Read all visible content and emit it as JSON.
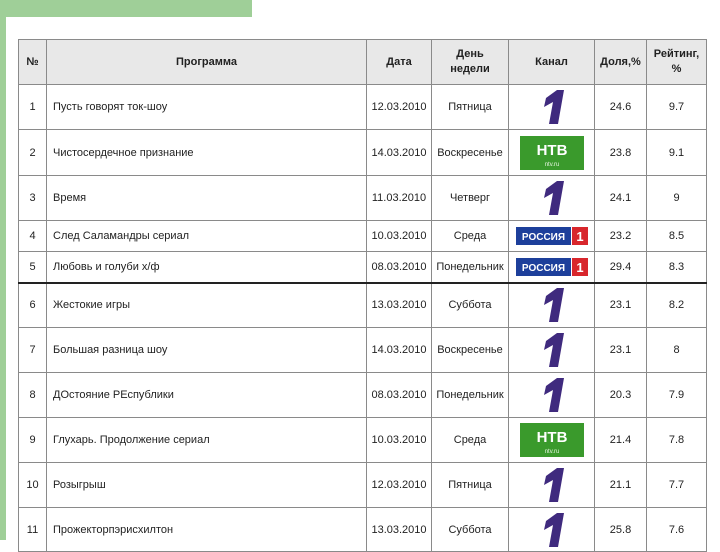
{
  "headers": {
    "num": "№",
    "program": "Программа",
    "date": "Дата",
    "day_line1": "День",
    "day_line2": "недели",
    "channel": "Канал",
    "share": "Доля,%",
    "rating_line1": "Рейтинг,",
    "rating_line2": "%"
  },
  "channel_logos": {
    "perviy": {
      "icon": "channel-one-logo",
      "color": "#3f2a7e"
    },
    "ntv": {
      "icon": "ntv-logo",
      "color": "#3a9a2c",
      "text": "НТВ",
      "subtext": "ntv.ru"
    },
    "rossiya": {
      "icon": "rossiya-1-logo",
      "color": "#1d3f9b",
      "accent": "#d8262c",
      "text": "РОССИЯ",
      "digit": "1"
    }
  },
  "rows": [
    {
      "num": "1",
      "program": "Пусть говорят ток-шоу",
      "date": "12.03.2010",
      "day": "Пятница",
      "channel": "perviy",
      "share": "24.6",
      "rating": "9.7"
    },
    {
      "num": "2",
      "program": "Чистосердечное признание",
      "date": "14.03.2010",
      "day": "Воскресенье",
      "channel": "ntv",
      "share": "23.8",
      "rating": "9.1"
    },
    {
      "num": "3",
      "program": "Время",
      "date": "11.03.2010",
      "day": "Четверг",
      "channel": "perviy",
      "share": "24.1",
      "rating": "9"
    },
    {
      "num": "4",
      "program": "След Саламандры сериал",
      "date": "10.03.2010",
      "day": "Среда",
      "channel": "rossiya",
      "share": "23.2",
      "rating": "8.5"
    },
    {
      "num": "5",
      "program": "Любовь и голуби х/ф",
      "date": "08.03.2010",
      "day": "Понедельник",
      "channel": "rossiya",
      "share": "29.4",
      "rating": "8.3"
    },
    {
      "num": "6",
      "program": "Жестокие игры",
      "date": "13.03.2010",
      "day": "Суббота",
      "channel": "perviy",
      "share": "23.1",
      "rating": "8.2"
    },
    {
      "num": "7",
      "program": "Большая разница шоу",
      "date": "14.03.2010",
      "day": "Воскресенье",
      "channel": "perviy",
      "share": "23.1",
      "rating": "8"
    },
    {
      "num": "8",
      "program": "ДОстояние РЕспублики",
      "date": "08.03.2010",
      "day": "Понедельник",
      "channel": "perviy",
      "share": "20.3",
      "rating": "7.9"
    },
    {
      "num": "9",
      "program": "Глухарь. Продолжение сериал",
      "date": "10.03.2010",
      "day": "Среда",
      "channel": "ntv",
      "share": "21.4",
      "rating": "7.8"
    },
    {
      "num": "10",
      "program": "Розыгрыш",
      "date": "12.03.2010",
      "day": "Пятница",
      "channel": "perviy",
      "share": "21.1",
      "rating": "7.7"
    },
    {
      "num": "11",
      "program": "Прожекторпэрисхилтон",
      "date": "13.03.2010",
      "day": "Суббота",
      "channel": "perviy",
      "share": "25.8",
      "rating": "7.6"
    }
  ]
}
